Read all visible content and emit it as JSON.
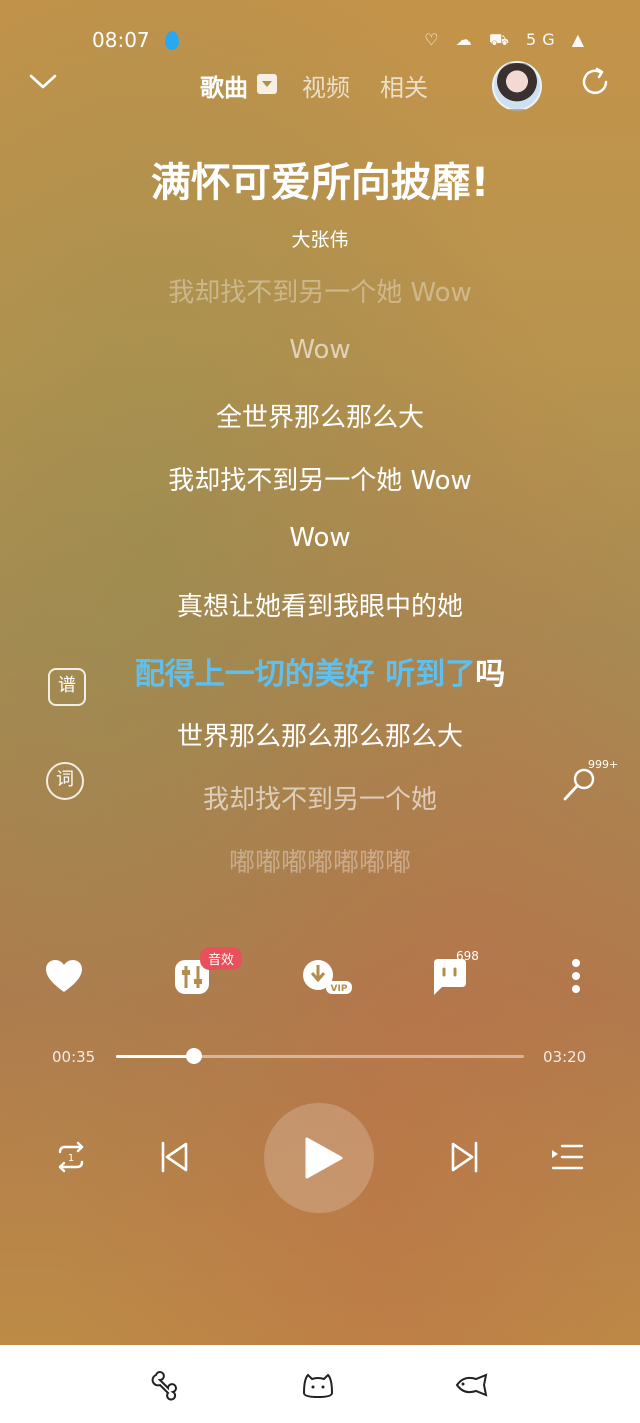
{
  "status_bar": {
    "time": "08:07",
    "icons": "♡ ☁ ⛟ 5G ▲",
    "accent": "#29a8f0"
  },
  "header": {
    "tabs": [
      {
        "label": "歌曲",
        "active": true
      },
      {
        "label": "视频",
        "active": false
      },
      {
        "label": "相关",
        "active": false
      }
    ]
  },
  "song": {
    "title": "满怀可爱所向披靡!",
    "artist": "大张伟"
  },
  "lyrics": [
    {
      "text": "我却找不到另一个她 Wow"
    },
    {
      "text": "Wow"
    },
    {
      "text": "全世界那么那么大"
    },
    {
      "text": "我却找不到另一个她 Wow"
    },
    {
      "text": "Wow"
    },
    {
      "text": "真想让她看到我眼中的她"
    },
    {
      "sung": "配得上一切的美好 听到了",
      "unsung": "吗"
    },
    {
      "text": "世界那么那么那么那么大"
    },
    {
      "text": "我却找不到另一个她"
    },
    {
      "text": "嘟嘟嘟嘟嘟嘟嘟"
    }
  ],
  "side_buttons": {
    "score_label": "谱",
    "lyrics_label": "词",
    "mic_count": "999+"
  },
  "actions": {
    "sound_effect_badge": "音效",
    "vip_label": "VIP",
    "comment_count": "698"
  },
  "player": {
    "current_time": "00:35",
    "total_time": "03:20",
    "progress": 0.19
  },
  "colors": {
    "highlight": "#5fc0ef",
    "badge": "#e8505b"
  }
}
